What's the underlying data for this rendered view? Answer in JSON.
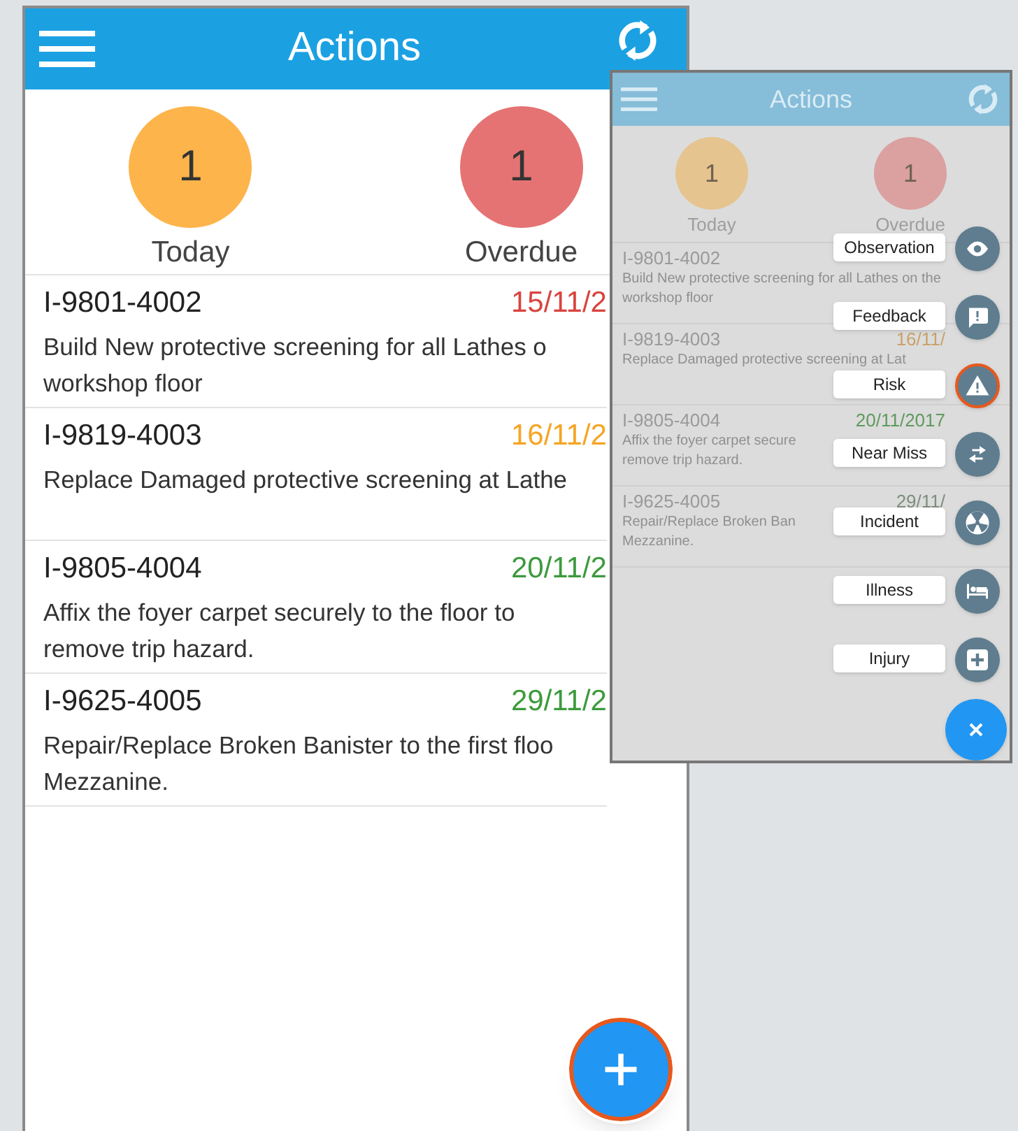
{
  "screens": [
    {
      "kind": "main",
      "header": {
        "title": "Actions"
      },
      "counters": [
        {
          "count": "1",
          "label": "Today",
          "color": "#fdb44b"
        },
        {
          "count": "1",
          "label": "Overdue",
          "color": "#e57373"
        }
      ],
      "rows": [
        {
          "id": "I-9801-4002",
          "date": "15/11/2",
          "color": "#d9443f",
          "lines": [
            "Build New protective screening for all Lathes o",
            "workshop floor"
          ]
        },
        {
          "id": "I-9819-4003",
          "date": "16/11/2",
          "color": "#f5a524",
          "lines": [
            "Replace Damaged protective screening at Lathe"
          ]
        },
        {
          "id": "I-9805-4004",
          "date": "20/11/2",
          "color": "#3c9a3c",
          "lines": [
            "Affix the foyer carpet securely to the floor to",
            "remove trip hazard."
          ]
        },
        {
          "id": "I-9625-4005",
          "date": "29/11/2",
          "color": "#3c9a3c",
          "lines": [
            "Repair/Replace Broken Banister to the first floo",
            "Mezzanine."
          ]
        }
      ]
    },
    {
      "kind": "menu_open",
      "header": {
        "title": "Actions"
      },
      "counters": [
        {
          "count": "1",
          "label": "Today",
          "color": "#e6c48f"
        },
        {
          "count": "1",
          "label": "Overdue",
          "color": "#dba0a0"
        }
      ],
      "rows": [
        {
          "id": "I-9801-4002",
          "lines": [
            "Build New protective screening for all Lathes on the",
            "workshop floor"
          ]
        },
        {
          "id": "I-9819-4003",
          "date": "16/11/",
          "color": "#c9a26a",
          "lines": [
            "Replace Damaged protective screening at Lat"
          ]
        },
        {
          "id": "I-9805-4004",
          "date": "20/11/2017",
          "color": "#5f9a5f",
          "lines": [
            "Affix the foyer carpet secure",
            "remove trip hazard."
          ]
        },
        {
          "id": "I-9625-4005",
          "date": "29/11/",
          "color": "#7e8e7e",
          "lines": [
            "Repair/Replace Broken Ban",
            "Mezzanine."
          ]
        }
      ],
      "menu": [
        {
          "label": "Observation",
          "selected": false
        },
        {
          "label": "Feedback",
          "selected": false
        },
        {
          "label": "Risk",
          "selected": true
        },
        {
          "label": "Near Miss",
          "selected": false
        },
        {
          "label": "Incident",
          "selected": false
        },
        {
          "label": "Illness",
          "selected": false
        },
        {
          "label": "Injury",
          "selected": false
        }
      ]
    }
  ]
}
